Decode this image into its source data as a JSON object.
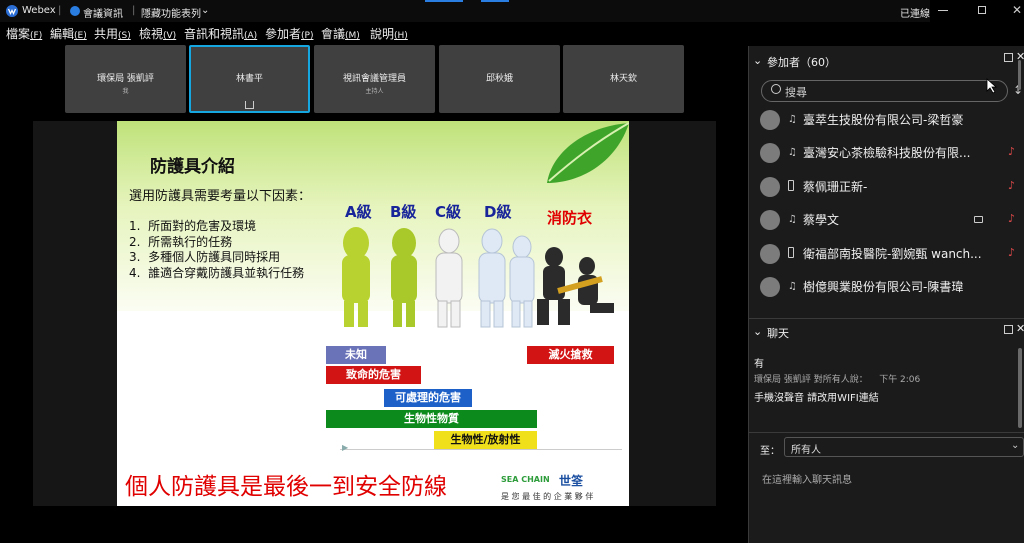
{
  "titlebar": {
    "app_name": "Webex",
    "meeting_info": "會議資訊",
    "hidden_features": "隱藏功能表列",
    "status": "已連線"
  },
  "menubar": {
    "items": [
      {
        "label": "檔案",
        "key": "(F)"
      },
      {
        "label": "編輯",
        "key": "(E)"
      },
      {
        "label": "共用",
        "key": "(S)"
      },
      {
        "label": "檢視",
        "key": "(V)"
      },
      {
        "label": "音訊和視訊",
        "key": "(A)"
      },
      {
        "label": "參加者",
        "key": "(P)"
      },
      {
        "label": "會議",
        "key": "(M)"
      },
      {
        "label": "說明",
        "key": "(H)"
      }
    ]
  },
  "tiles": [
    {
      "name": "環保局 張凱評",
      "role": "我"
    },
    {
      "name": "林書平",
      "role": ""
    },
    {
      "name": "視訊會議管理員",
      "role": "主持人"
    },
    {
      "name": "邱秋娥",
      "role": ""
    },
    {
      "name": "林天欽",
      "role": ""
    }
  ],
  "slide": {
    "title": "防護具介紹",
    "subtitle": "選用防護具需要考量以下因素：",
    "factors": [
      "所面對的危害及環境",
      "所需執行的任務",
      "多種個人防護具同時採用",
      "誰適合穿戴防護具並執行任務"
    ],
    "levels": [
      "A級",
      "B級",
      "C級",
      "D級"
    ],
    "fire_suit": "消防衣",
    "bars": {
      "unknown": "未知",
      "lethal": "致命的危害",
      "manageable": "可處理的危害",
      "biological": "生物性物質",
      "bio_radio": "生物性/放射性",
      "firefight": "滅火搶救"
    },
    "banner": "個人防護具是最後一到安全防線",
    "logo_en": "SEA CHAIN",
    "logo_cn": "世筌",
    "logo_slogan": "是 您 最 佳 的 企 業 夥 伴"
  },
  "participants": {
    "header": "參加者",
    "count": "（60）",
    "search_placeholder": "搜尋",
    "list": [
      {
        "name": "臺萃生技股份有限公司-梁哲豪"
      },
      {
        "name": "臺灣安心茶檢驗科技股份有限..."
      },
      {
        "name": "蔡佩珊正新-"
      },
      {
        "name": "蔡學文"
      },
      {
        "name": "衛福部南投醫院-劉婉甄 wanch..."
      },
      {
        "name": "樹億興業股份有限公司-陳書瑋"
      }
    ]
  },
  "chat": {
    "header": "聊天",
    "messages": [
      {
        "text": "有",
        "meta": "環保局 張凱評 對所有人說：",
        "time": "下午 2:06"
      },
      {
        "text": "手機沒聲音 請改用WIFI連結"
      }
    ],
    "to_label": "至：",
    "to_value": "所有人",
    "input_placeholder": "在這裡輸入聊天訊息"
  },
  "colors": {
    "accent": "#16a6e0",
    "panel_bg": "#1b1b1b",
    "slide_green": "#bfe27a",
    "banner_red": "#e00000"
  }
}
